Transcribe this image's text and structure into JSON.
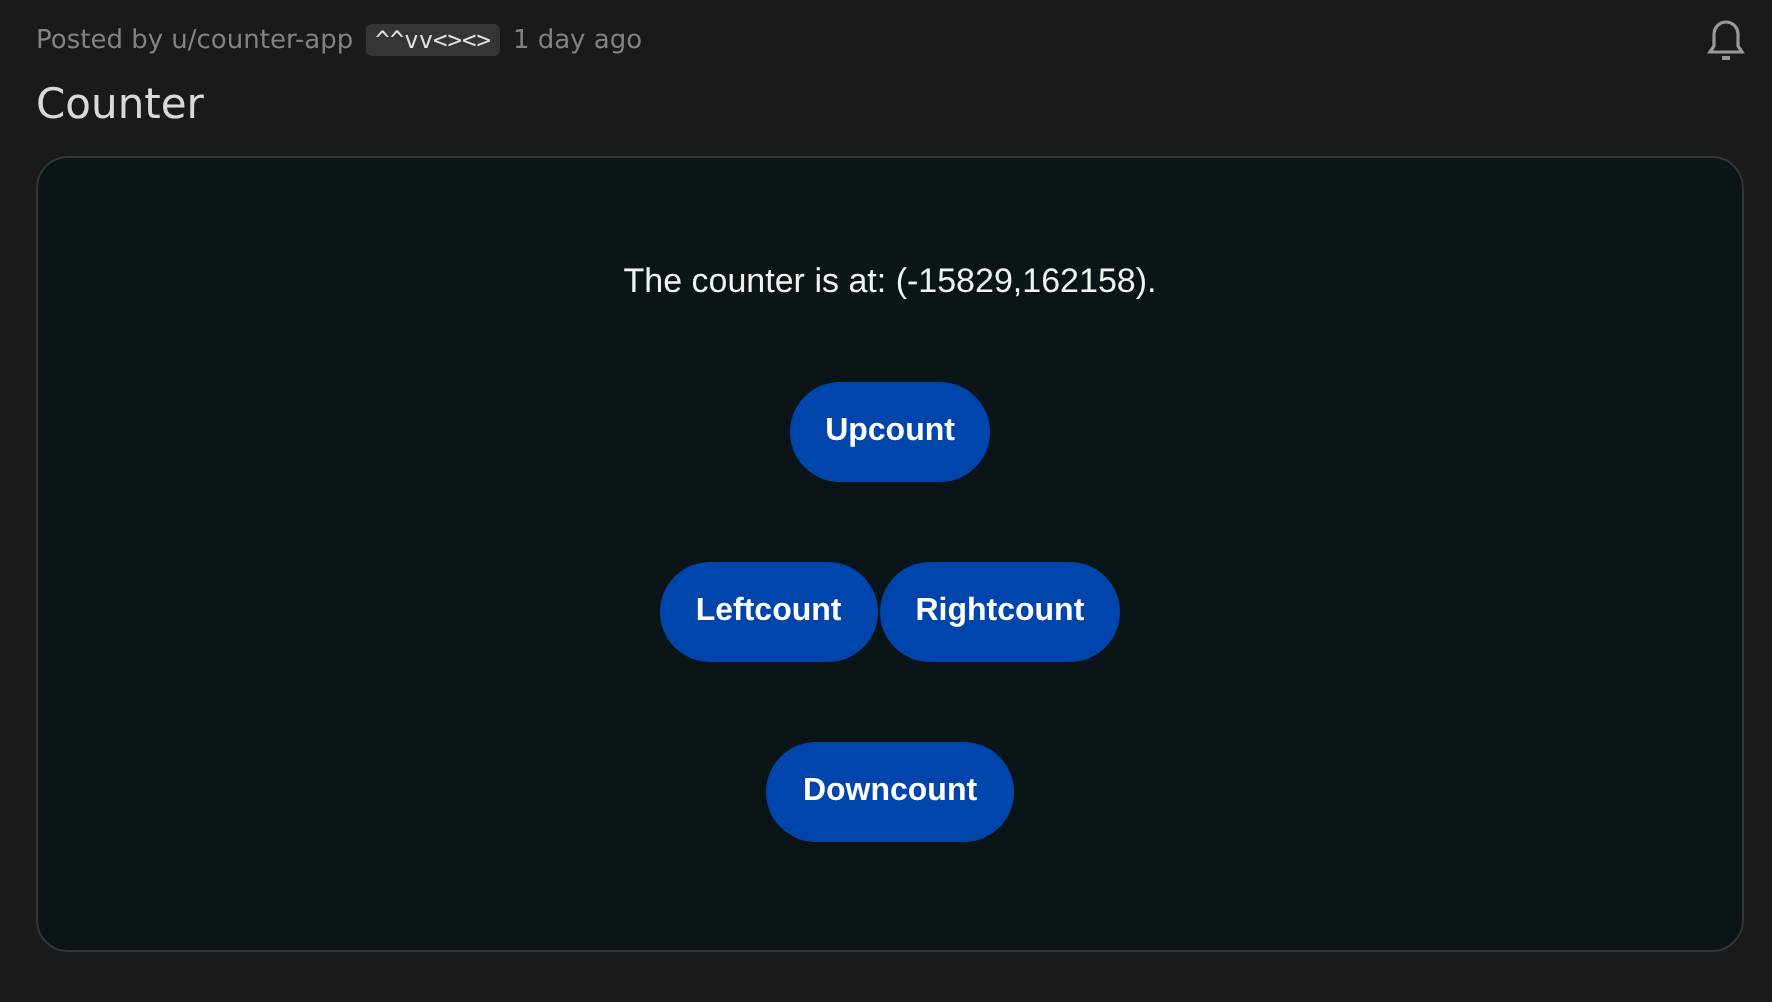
{
  "post": {
    "byline": "Posted by u/counter-app",
    "flair": "^^vv<><>",
    "time": "1 day ago",
    "title": "Counter"
  },
  "app": {
    "message": "The counter is at: (-15829,162158).",
    "button_rows": [
      {
        "buttons": [
          "Upcount"
        ]
      },
      {
        "buttons": [
          "Leftcount",
          "Rightcount"
        ]
      },
      {
        "buttons": [
          "Downcount"
        ]
      }
    ]
  }
}
